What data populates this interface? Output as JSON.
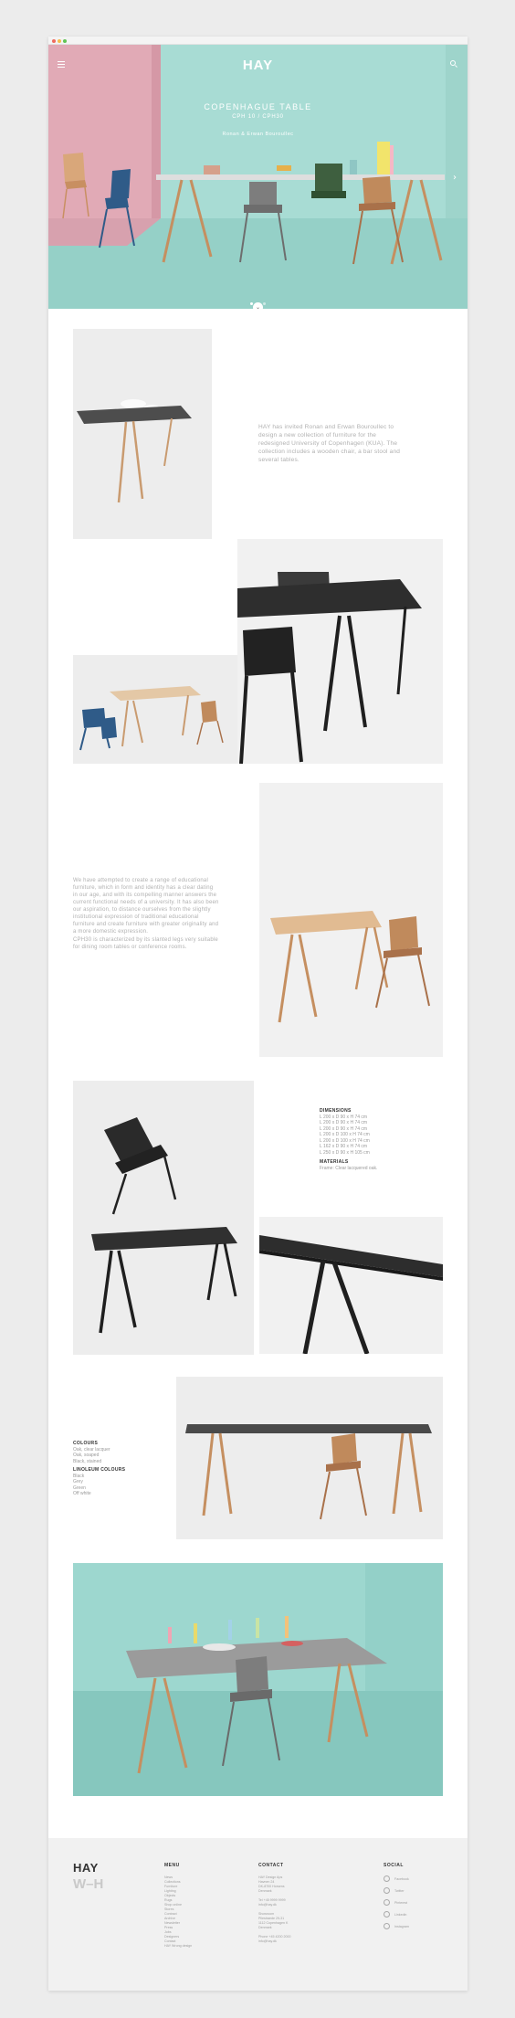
{
  "hero": {
    "logo": "HAY",
    "title": "COPENHAGUE TABLE",
    "subtitle": "CPH 10 / CPH30",
    "designer": "Ronan & Erwan Bouroullec"
  },
  "intro_text": "HAY has invited Ronan and Erwan Bouroullec to design a new collection of furniture for the redesigned University of Copenhagen (KUA). The collection includes a wooden chair, a bar stool and several tables.",
  "section2_text_1": "We have attempted to create a range of educational furniture, which in form and identity has a clear dating in our age, and with its compelling manner answers the current functional needs of a university. It has also been our aspiration, to distance ourselves from the slightly institutional expression of traditional educational furniture and create furniture with greater originality and a more domestic expression.",
  "section2_text_2": "CPH30 is characterized by its slanted legs very suitable for dining room tables or conference rooms.",
  "dimensions": {
    "heading": "DIMENSIONS",
    "rows": [
      "L 200 x D 90 x H 74 cm",
      "L 200 x D 90 x H 74 cm",
      "L 200 x D 90 x H 74 cm",
      "L 200 x D 100 x H 74 cm",
      "L 200 x D 100 x H 74 cm",
      "L 162 x D 90 x H 74 cm",
      "L 250 x D 90 x H 105 cm"
    ],
    "materials_heading": "MATERIALS",
    "materials": "Frame: Clear lacquered oak."
  },
  "colours": {
    "heading": "COLOURS",
    "items": [
      "Oak, clear lacquer",
      "Oak, soaped",
      "Black, stained"
    ],
    "lino_heading": "LINOLEUM COLOURS",
    "lino_items": [
      "Black",
      "Grey",
      "Green",
      "Off white"
    ]
  },
  "footer": {
    "logo": "HAY",
    "mark": "W–H",
    "menu_heading": "MENU",
    "menu_items": [
      "News",
      "Collections",
      "Furniture",
      "Lighting",
      "Objects",
      "Rugs",
      "Shop online",
      "Stores",
      "Contract",
      "Archive",
      "Newsletter",
      "Press",
      "Jobs",
      "Designers",
      "Contact",
      "HAY Wrong design"
    ],
    "contact_heading": "CONTACT",
    "contact_items": [
      "HAY Design Aps",
      "Havnen 24",
      "DK-8700 Horsens",
      "Denmark",
      "",
      "Tel +45 9999 9999",
      "info@hay.dk",
      "",
      "Showroom",
      "Pilestraede 29-31",
      "1112 Copenhagen K",
      "Denmark",
      "",
      "Phone +45 4200 2000",
      "info@hay.dk"
    ],
    "social_heading": "SOCIAL",
    "social_items": [
      "Facebook",
      "Twitter",
      "Pinterest",
      "Linkedin",
      "Instagram"
    ]
  },
  "colors": {
    "hero_wall": "#a8dcd4",
    "hero_pink": "#e1aab6",
    "text_grey": "#b0b0b0"
  }
}
